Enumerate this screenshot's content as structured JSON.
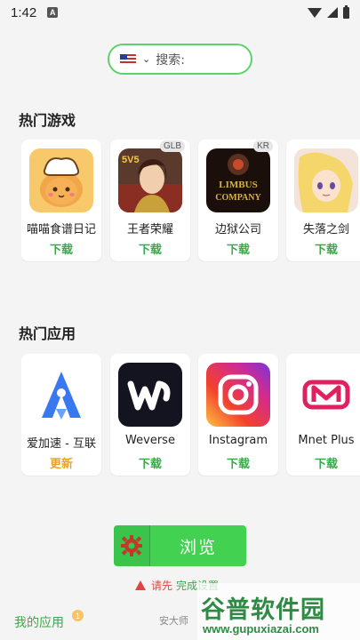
{
  "status_bar": {
    "time": "1:42",
    "notification_icon": "A",
    "icons": [
      "wifi-icon",
      "signal-icon",
      "battery-icon"
    ]
  },
  "search": {
    "flag_icon": "us-flag-icon",
    "placeholder": "搜索:"
  },
  "hot_games": {
    "title": "热门游戏",
    "items": [
      {
        "name": "喵喵食谱日记",
        "action": "下载",
        "badge": ""
      },
      {
        "name": "王者荣耀",
        "action": "下载",
        "badge": "GLB"
      },
      {
        "name": "边狱公司",
        "action": "下载",
        "badge": "KR"
      },
      {
        "name": "失落之剑",
        "action": "下载",
        "badge": ""
      }
    ]
  },
  "hot_apps": {
    "title": "热门应用",
    "items": [
      {
        "name": "爱加速 - 互联",
        "action": "更新"
      },
      {
        "name": "Weverse",
        "action": "下载"
      },
      {
        "name": "Instagram",
        "action": "下载"
      },
      {
        "name": "Mnet Plus",
        "action": "下载"
      }
    ]
  },
  "browse_button": {
    "label": "浏览"
  },
  "setup_warning": {
    "text": "请先",
    "link": "完成设置"
  },
  "bottom": {
    "my_apps": "我的应用",
    "my_apps_count": "1",
    "partial_label": "安大师"
  },
  "watermark": {
    "title": "谷普软件园",
    "url": "www.gupuxiazai.com"
  },
  "colors": {
    "accent_green": "#43d152",
    "update_orange": "#e9a22a",
    "warning_red": "#e04545"
  }
}
